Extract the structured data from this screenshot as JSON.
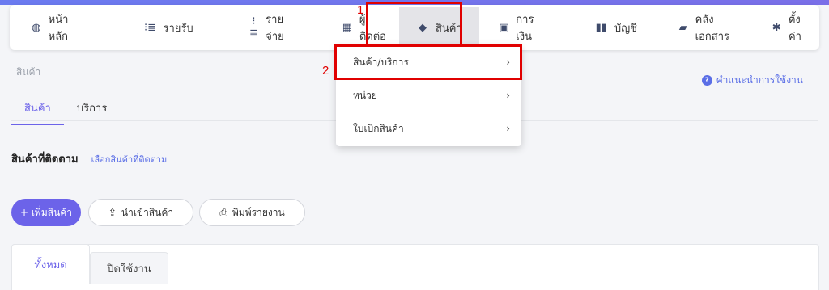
{
  "nav": {
    "items": [
      {
        "label": "หน้าหลัก",
        "icon": "dashboard-icon",
        "glyph": "◍"
      },
      {
        "label": "รายรับ",
        "icon": "income-list-icon",
        "glyph": "⁝≣"
      },
      {
        "label": "รายจ่าย",
        "icon": "expense-list-icon",
        "glyph": "⁝≣"
      },
      {
        "label": "ผู้ติดต่อ",
        "icon": "contacts-icon",
        "glyph": "▦"
      },
      {
        "label": "สินค้า",
        "icon": "cube-icon",
        "glyph": "◆"
      },
      {
        "label": "การเงิน",
        "icon": "money-icon",
        "glyph": "▣"
      },
      {
        "label": "บัญชี",
        "icon": "ledger-icon",
        "glyph": "▮▮"
      },
      {
        "label": "คลังเอกสาร",
        "icon": "folder-icon",
        "glyph": "▰"
      },
      {
        "label": "ตั้งค่า",
        "icon": "gear-icon",
        "glyph": "✱"
      }
    ]
  },
  "annotations": {
    "step1": "1",
    "step2": "2"
  },
  "dropdown": {
    "items": [
      {
        "label": "สินค้า/บริการ",
        "chevron": "›"
      },
      {
        "label": "หน่วย",
        "chevron": "›"
      },
      {
        "label": "ใบเบิกสินค้า",
        "chevron": "›"
      }
    ]
  },
  "breadcrumb": "สินค้า",
  "help_link": "คำแนะนำการใช้งาน",
  "help_glyph": "?",
  "tabs": [
    {
      "label": "สินค้า"
    },
    {
      "label": "บริการ"
    }
  ],
  "followed": {
    "title": "สินค้าที่ติดตาม",
    "link": "เลือกสินค้าที่ติดตาม"
  },
  "buttons": {
    "add": "+ เพิ่มสินค้า",
    "import": "นำเข้าสินค้า",
    "import_glyph": "⇪",
    "print": "พิมพ์รายงาน",
    "print_glyph": "⎙"
  },
  "sub_tabs": [
    {
      "label": "ทั้งหมด"
    },
    {
      "label": "ปิดใช้งาน"
    }
  ],
  "colors": {
    "accent": "#6c63e9",
    "link": "#5a6ee6",
    "highlight": "#e00000"
  }
}
